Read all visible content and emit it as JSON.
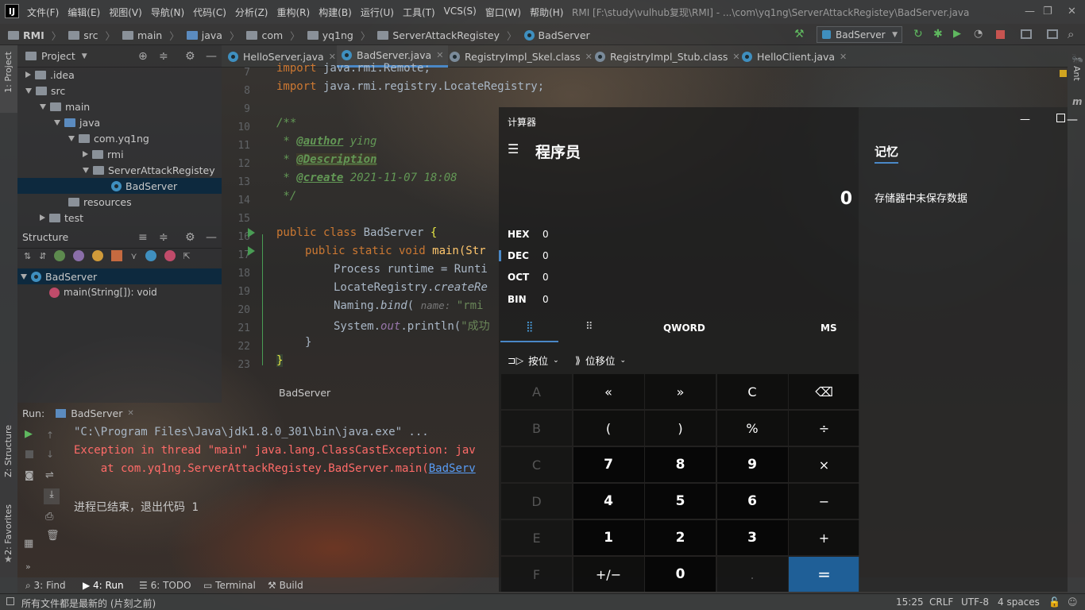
{
  "menubar": {
    "logo": "IJ",
    "items": [
      "文件(F)",
      "编辑(E)",
      "视图(V)",
      "导航(N)",
      "代码(C)",
      "分析(Z)",
      "重构(R)",
      "构建(B)",
      "运行(U)",
      "工具(T)",
      "VCS(S)",
      "窗口(W)",
      "帮助(H)"
    ],
    "window_title": "RMI [F:\\study\\vulhub复现\\RMI] - ...\\com\\yq1ng\\ServerAttackRegistey\\BadServer.java"
  },
  "breadcrumb": [
    "RMI",
    "src",
    "main",
    "java",
    "com",
    "yq1ng",
    "ServerAttackRegistey",
    "BadServer"
  ],
  "run_config": "BadServer",
  "left_stripe": {
    "project": "1: Project",
    "structure": "Z: Structure",
    "favorites": "2: Favorites"
  },
  "right_stripe": {
    "ant": "Ant"
  },
  "project_panel": {
    "title": "Project",
    "tree": [
      ".idea",
      "src",
      "main",
      "java",
      "com.yq1ng",
      "rmi",
      "ServerAttackRegistey",
      "BadServer",
      "resources",
      "test"
    ]
  },
  "structure_panel": {
    "title": "Structure",
    "class_name": "BadServer",
    "method": "main(String[]): void"
  },
  "tabs": [
    "HelloServer.java",
    "BadServer.java",
    "RegistryImpl_Skel.class",
    "RegistryImpl_Stub.class",
    "HelloClient.java"
  ],
  "editor": {
    "line_numbers": [
      "7",
      "8",
      "9",
      "10",
      "11",
      "12",
      "13",
      "14",
      "15",
      "16",
      "17",
      "18",
      "19",
      "20",
      "21",
      "22",
      "23"
    ],
    "imp1_kw": "import",
    "imp1": " java.rmi.Remote;",
    "imp2_kw": "import",
    "imp2": " java.rmi.registry.LocateRegistry;",
    "doc_open": "/**",
    "doc_star": " * ",
    "author_tag": "@author",
    "author_val": " ying",
    "desc_tag": "@Description",
    "create_tag": "@create",
    "create_val": " 2021-11-07 18:08",
    "doc_close": " */",
    "l15_kw": "public class",
    "l15_name": " BadServer ",
    "brace_open": "{",
    "l16_kw": "public static void",
    "l16_rest": " main(Str",
    "l17": "Process runtime = Runti",
    "l18_a": "LocateRegistry.",
    "l18_b": "createRe",
    "l19_a": "Naming.",
    "l19_b": "bind",
    "l19_c": "( ",
    "l19_hint": "name: ",
    "l19_d": "\"rmi",
    "l20_a": "System.",
    "l20_b": "out",
    "l20_c": ".println(",
    "l20_d": "\"成功",
    "l21": "}",
    "l22": "}",
    "crumb": "BadServer"
  },
  "run": {
    "label": "Run:",
    "tab": "BadServer",
    "line1": "\"C:\\Program Files\\Java\\jdk1.8.0_301\\bin\\java.exe\" ...",
    "line2": "Exception in thread \"main\" java.lang.ClassCastException: jav",
    "line3_a": "    at com.yq1ng.ServerAttackRegistey.BadServer.main(",
    "line3_link": "BadServ",
    "line4": "进程已结束，退出代码 1"
  },
  "bottom_tabs": {
    "find": "3: Find",
    "run": "4: Run",
    "todo": "6: TODO",
    "terminal": "Terminal",
    "build": "Build"
  },
  "status": {
    "message": "所有文件都是最新的 (片刻之前)",
    "position": "15:25",
    "line_sep": "CRLF",
    "encoding": "UTF-8",
    "indent": "4 spaces"
  },
  "calc": {
    "app_title": "计算器",
    "mode": "程序员",
    "display": "0",
    "memory_title": "记忆",
    "memory_empty": "存储器中未保存数据",
    "radix": [
      {
        "name": "HEX",
        "value": "0"
      },
      {
        "name": "DEC",
        "value": "0"
      },
      {
        "name": "OCT",
        "value": "0"
      },
      {
        "name": "BIN",
        "value": "0"
      }
    ],
    "word_size": "QWORD",
    "ms": "MS",
    "bitwise": "按位",
    "bitshift": "位移位",
    "keys": [
      "A",
      "«",
      "»",
      "C",
      "⌫",
      "B",
      "(",
      ")",
      "%",
      "÷",
      "C",
      "7",
      "8",
      "9",
      "×",
      "D",
      "4",
      "5",
      "6",
      "−",
      "E",
      "1",
      "2",
      "3",
      "+",
      "F",
      "+/−",
      "0",
      ".",
      "="
    ]
  },
  "colors": {
    "accent": "#4a88c7",
    "calc_equals": "#1f5f97",
    "error": "#ff6b68",
    "keyword": "#cc7832"
  }
}
